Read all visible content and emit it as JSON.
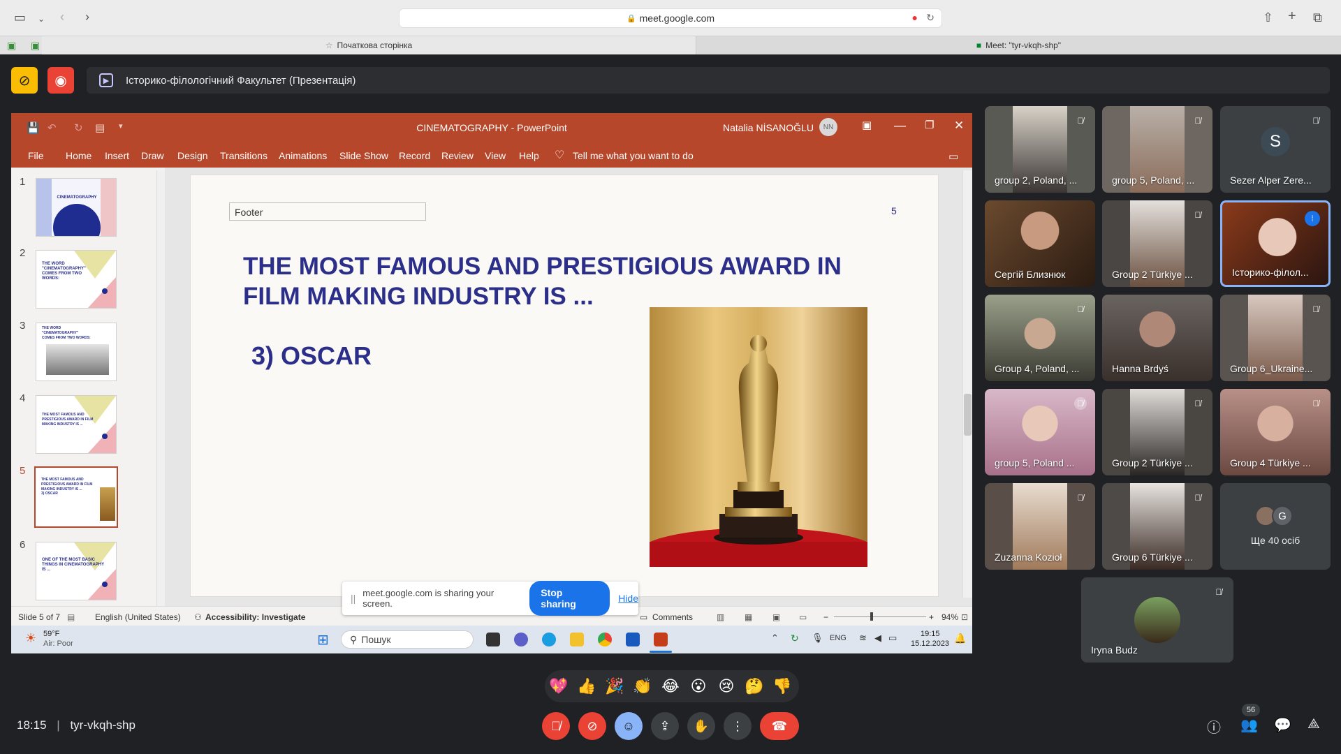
{
  "browser": {
    "url": "meet.google.com",
    "tab1": "Початкова сторінка",
    "tab2": "Meet: \"tyr-vkqh-shp\""
  },
  "meet": {
    "presentation_title": "Історико-філологічний Факультет (Презентація)",
    "time": "18:15",
    "meeting_code": "tyr-vkqh-shp",
    "participant_count": "56",
    "more_people": "Ще 40 осіб",
    "sharing_notice": "meet.google.com is sharing your screen.",
    "stop_sharing": "Stop sharing",
    "hide": "Hide"
  },
  "powerpoint": {
    "file_title": "CINEMATOGRAPHY",
    "app_name": "PowerPoint",
    "user": "Natalia NİSANOĞLU",
    "user_initials": "NN",
    "menu": [
      "File",
      "Home",
      "Insert",
      "Draw",
      "Design",
      "Transitions",
      "Animations",
      "Slide Show",
      "Record",
      "Review",
      "View",
      "Help"
    ],
    "tell_me": "Tell me what you want to do",
    "thumbs": [
      {
        "num": "1",
        "text": "CINEMATOGRAPHY"
      },
      {
        "num": "2",
        "text": "THE WORD \"CINEMATOGRAPHY\" COMES FROM TWO WORDS:"
      },
      {
        "num": "3",
        "text": "THE WORD \"CINEMATOGRAPHY\" COMES FROM TWO WORDS:"
      },
      {
        "num": "4",
        "text": "THE MOST FAMOUS AND PRESTIGIOUS AWARD IN FILM MAKING INDUSTRY IS ..."
      },
      {
        "num": "5",
        "text": "THE MOST FAMOUS AND PRESTIGIOUS AWARD IN FILM MAKING INDUSTRY IS ..."
      },
      {
        "num": "6",
        "text": "ONE OF THE MOST BASIC THINGS IN CINEMATOGRAPHY IS ..."
      }
    ],
    "slide": {
      "footer": "Footer",
      "number": "5",
      "title": "THE MOST FAMOUS AND PRESTIGIOUS AWARD IN FILM MAKING INDUSTRY IS  ...",
      "answer": "3) OSCAR"
    },
    "status": {
      "slide_of": "Slide 5 of 7",
      "language": "English (United States)",
      "accessibility": "Accessibility: Investigate",
      "comments": "Comments",
      "zoom": "94%"
    }
  },
  "taskbar": {
    "weather_temp": "59°F",
    "weather_note": "Air: Poor",
    "search": "Пошук",
    "lang": "ENG",
    "time": "19:15",
    "date": "15.12.2023"
  },
  "participants": [
    {
      "name": "group 2, Poland, ..."
    },
    {
      "name": "group 5, Poland, ..."
    },
    {
      "name": "Sezer Alper Zere...",
      "letter": "S"
    },
    {
      "name": "Сергій Близнюк"
    },
    {
      "name": "Group 2 Türkiye ..."
    },
    {
      "name": "Історико-філол..."
    },
    {
      "name": "Group 4, Poland, ..."
    },
    {
      "name": "Hanna Brdyś"
    },
    {
      "name": "Group 6_Ukraine..."
    },
    {
      "name": "group 5, Poland ..."
    },
    {
      "name": "Group 2 Türkiye ..."
    },
    {
      "name": "Group 4 Türkiye ..."
    },
    {
      "name": "Zuzanna Kozioł"
    },
    {
      "name": "Group 6 Türkiye ..."
    },
    {
      "name": "Iryna Budz"
    }
  ],
  "more_letter": "G",
  "colors": {
    "ppt_accent": "#b7472a",
    "slide_title": "#2b2f8a",
    "meet_bg": "#202124",
    "hangup": "#ea4335",
    "blue": "#1a73e8"
  }
}
